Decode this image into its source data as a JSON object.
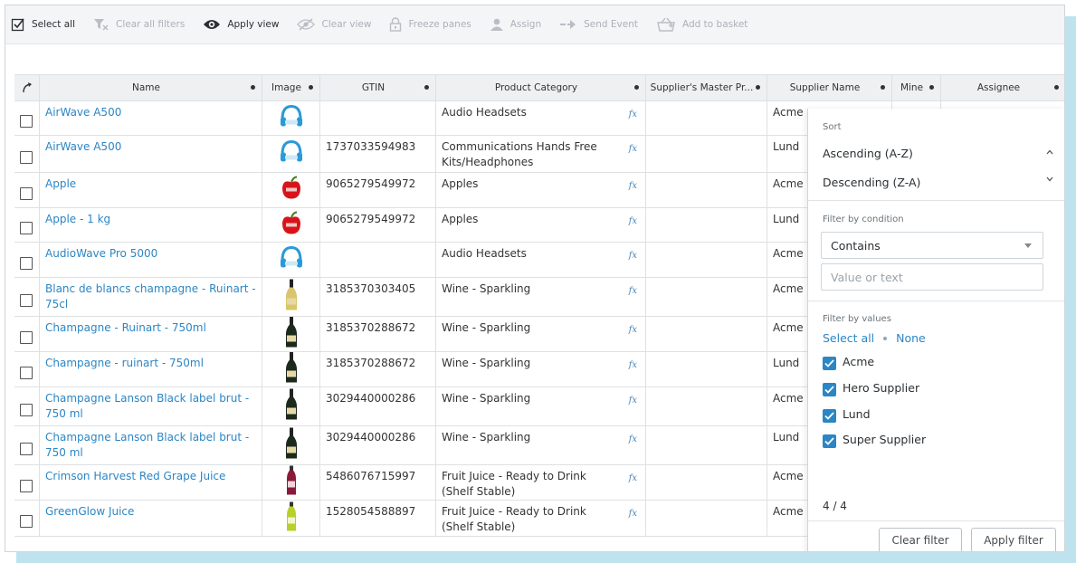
{
  "toolbar": {
    "select_all": "Select all",
    "clear_all_filters": "Clear all filters",
    "apply_view": "Apply view",
    "clear_view": "Clear view",
    "freeze_panes": "Freeze panes",
    "assign": "Assign",
    "send_event": "Send Event",
    "add_to_basket": "Add to basket"
  },
  "columns": {
    "name": "Name",
    "image": "Image",
    "gtin": "GTIN",
    "category": "Product Category",
    "supplier_master": "Supplier's Master Pr...",
    "supplier_name": "Supplier Name",
    "mine": "Mine",
    "assignee": "Assignee"
  },
  "rows": [
    {
      "name": "AirWave A500",
      "gtin": "",
      "category": "Audio Headsets",
      "supplier": "Acme",
      "image_icon": "headphones-icon"
    },
    {
      "name": "AirWave A500",
      "gtin": "1737033594983",
      "category": "Communications Hands Free Kits/Headphones",
      "supplier": "Lund",
      "image_icon": "headphones-icon"
    },
    {
      "name": "Apple",
      "gtin": "9065279549972",
      "category": "Apples",
      "supplier": "Acme",
      "image_icon": "apple-icon"
    },
    {
      "name": "Apple - 1 kg",
      "gtin": "9065279549972",
      "category": "Apples",
      "supplier": "Lund",
      "image_icon": "apple-icon"
    },
    {
      "name": "AudioWave Pro 5000",
      "gtin": "",
      "category": "Audio Headsets",
      "supplier": "Acme",
      "image_icon": "headphones-icon"
    },
    {
      "name": "Blanc de blancs champagne - Ruinart - 75cl",
      "gtin": "3185370303405",
      "category": "Wine - Sparkling",
      "supplier": "Acme",
      "image_icon": "bottle-icon"
    },
    {
      "name": "Champagne - Ruinart - 750ml",
      "gtin": "3185370288672",
      "category": "Wine - Sparkling",
      "supplier": "Acme",
      "image_icon": "bottle-icon"
    },
    {
      "name": "Champagne - ruinart - 750ml",
      "gtin": "3185370288672",
      "category": "Wine - Sparkling",
      "supplier": "Lund",
      "image_icon": "bottle-icon"
    },
    {
      "name": "Champagne Lanson Black label brut - 750 ml",
      "gtin": "3029440000286",
      "category": "Wine - Sparkling",
      "supplier": "Acme",
      "image_icon": "bottle-icon"
    },
    {
      "name": "Champagne Lanson Black label brut - 750 ml",
      "gtin": "3029440000286",
      "category": "Wine - Sparkling",
      "supplier": "Lund",
      "image_icon": "bottle-icon"
    },
    {
      "name": "Crimson Harvest Red Grape Juice",
      "gtin": "5486076715997",
      "category": "Fruit Juice - Ready to Drink (Shelf Stable)",
      "supplier": "Acme",
      "image_icon": "juice-bottle-icon"
    },
    {
      "name": "GreenGlow Juice",
      "gtin": "1528054588897",
      "category": "Fruit Juice - Ready to Drink (Shelf Stable)",
      "supplier": "Acme",
      "image_icon": "juice-bottle-icon"
    }
  ],
  "fx_label": "fx",
  "filter_panel": {
    "sort_title": "Sort",
    "ascending": "Ascending (A-Z)",
    "descending": "Descending (Z-A)",
    "condition_title": "Filter by condition",
    "condition_value": "Contains",
    "value_placeholder": "Value or text",
    "values_title": "Filter by values",
    "select_all": "Select all",
    "none": "None",
    "values": [
      "Acme",
      "Hero Supplier",
      "Lund",
      "Super Supplier"
    ],
    "count": "4 / 4",
    "clear_filter": "Clear filter",
    "apply_filter": "Apply filter"
  },
  "colors": {
    "link": "#2b86c5",
    "accent": "#2b86c5",
    "shadow": "#bfe3ee"
  }
}
